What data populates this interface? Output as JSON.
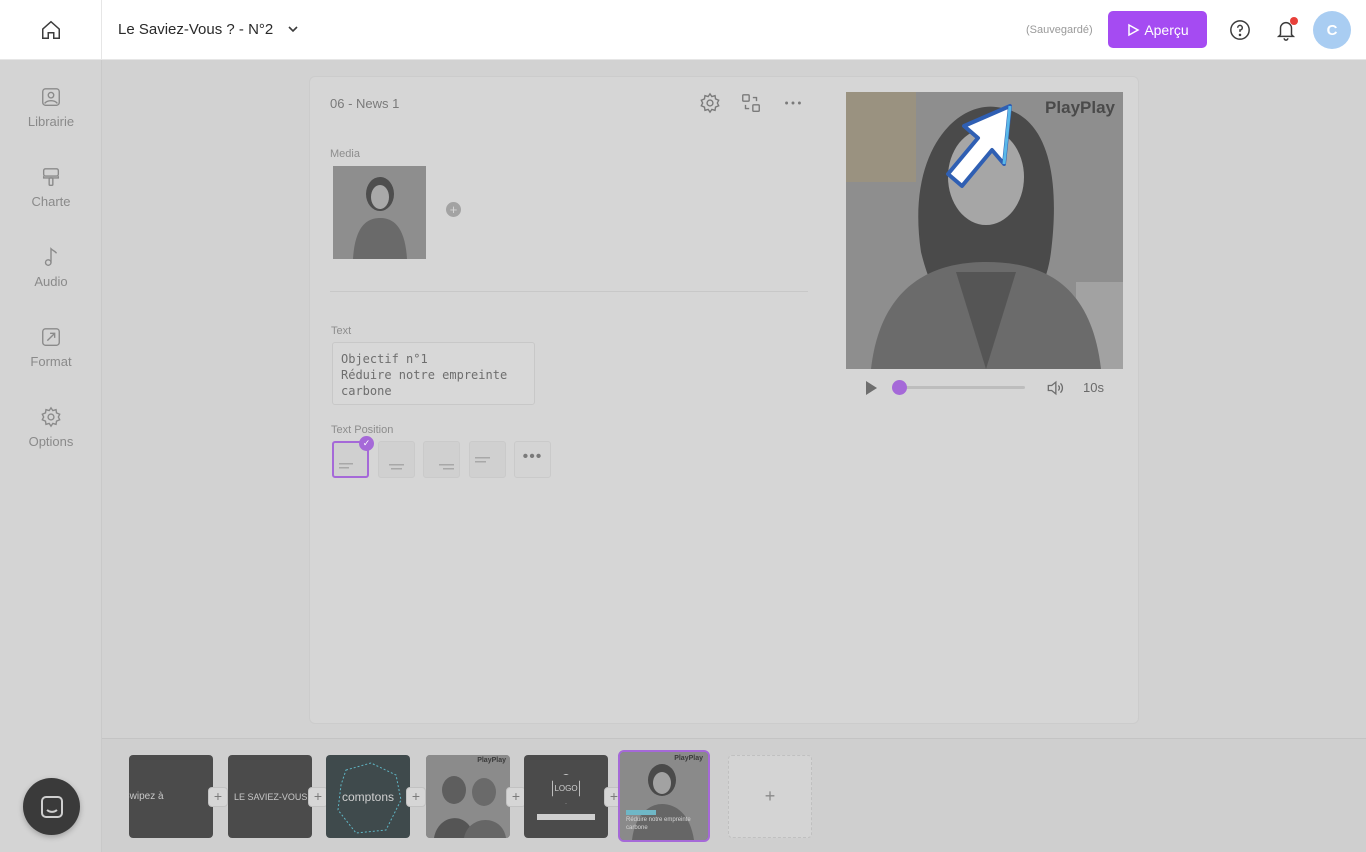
{
  "topbar": {
    "project_title": "Le Saviez-Vous ? - N°2",
    "saved_status": "(Sauvegardé)",
    "preview_label": "Aperçu",
    "avatar_initial": "C",
    "accent_color": "#a54bf2"
  },
  "sidebar": {
    "items": [
      {
        "label": "Librairie",
        "icon": "image-icon"
      },
      {
        "label": "Charte",
        "icon": "paint-roller-icon"
      },
      {
        "label": "Audio",
        "icon": "music-note-icon"
      },
      {
        "label": "Format",
        "icon": "resize-icon"
      },
      {
        "label": "Options",
        "icon": "gear-icon"
      }
    ]
  },
  "editor": {
    "slide_name": "06 - News 1",
    "media_label": "Media",
    "text_label": "Text",
    "text_value_lines": [
      "Objectif n°1",
      "Réduire notre empreinte",
      "carbone"
    ],
    "text_position_label": "Text Position",
    "text_position_selected": 0
  },
  "preview": {
    "brand": "PlayPlay",
    "duration": "10s",
    "progress": 0
  },
  "timeline": {
    "clips": [
      {
        "caption": "Swipez à"
      },
      {
        "caption": "LE SAVIEZ-VOUS ?"
      },
      {
        "caption": "comptons"
      },
      {
        "caption": "",
        "brand": "PlayPlay"
      },
      {
        "caption": "LOGO"
      },
      {
        "caption": "Réduire notre empreinte carbone",
        "brand": "PlayPlay",
        "selected": true
      }
    ],
    "add_label": "+"
  }
}
